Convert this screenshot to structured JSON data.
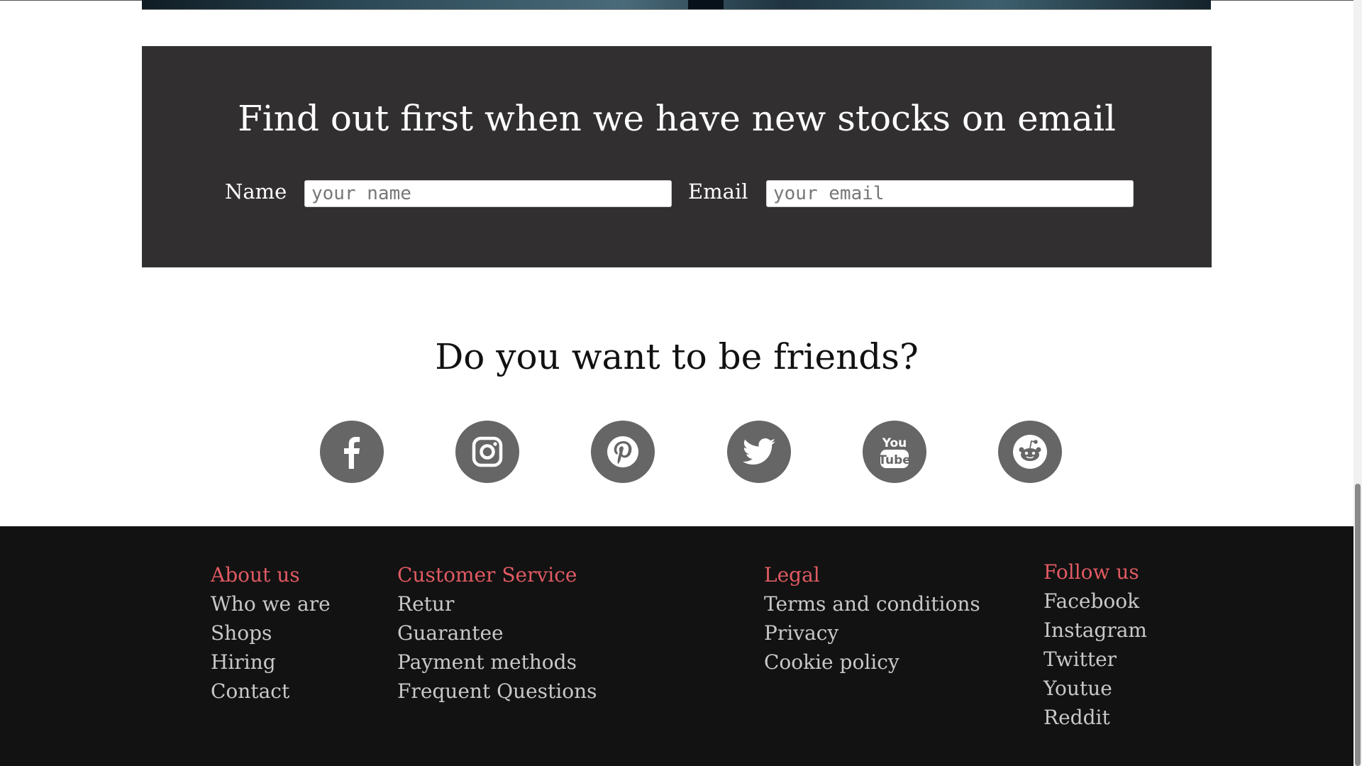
{
  "newsletter": {
    "title": "Find out first when we have new stocks on email",
    "name_label": "Name",
    "name_placeholder": "your name",
    "email_label": "Email",
    "email_placeholder": "your email"
  },
  "social": {
    "title": "Do you want to be friends?",
    "icons": [
      "facebook-icon",
      "instagram-icon",
      "pinterest-icon",
      "twitter-icon",
      "youtube-icon",
      "reddit-icon"
    ]
  },
  "footer": {
    "about": {
      "heading": "About us",
      "items": [
        "Who we are",
        "Shops",
        "Hiring",
        "Contact"
      ]
    },
    "service": {
      "heading": "Customer Service",
      "items": [
        "Retur",
        "Guarantee",
        "Payment methods",
        "Frequent Questions"
      ]
    },
    "legal": {
      "heading": "Legal",
      "items": [
        "Terms and conditions",
        "Privacy",
        "Cookie policy"
      ]
    },
    "follow": {
      "heading": "Follow us",
      "items": [
        "Facebook",
        "Instagram",
        "Twitter",
        "Youtue",
        "Reddit"
      ]
    }
  },
  "colors": {
    "newsletter_bg": "#312f30",
    "footer_bg": "#121212",
    "footer_heading": "#e05a63",
    "footer_link": "#c8c8c8",
    "social_circle": "#666666"
  }
}
